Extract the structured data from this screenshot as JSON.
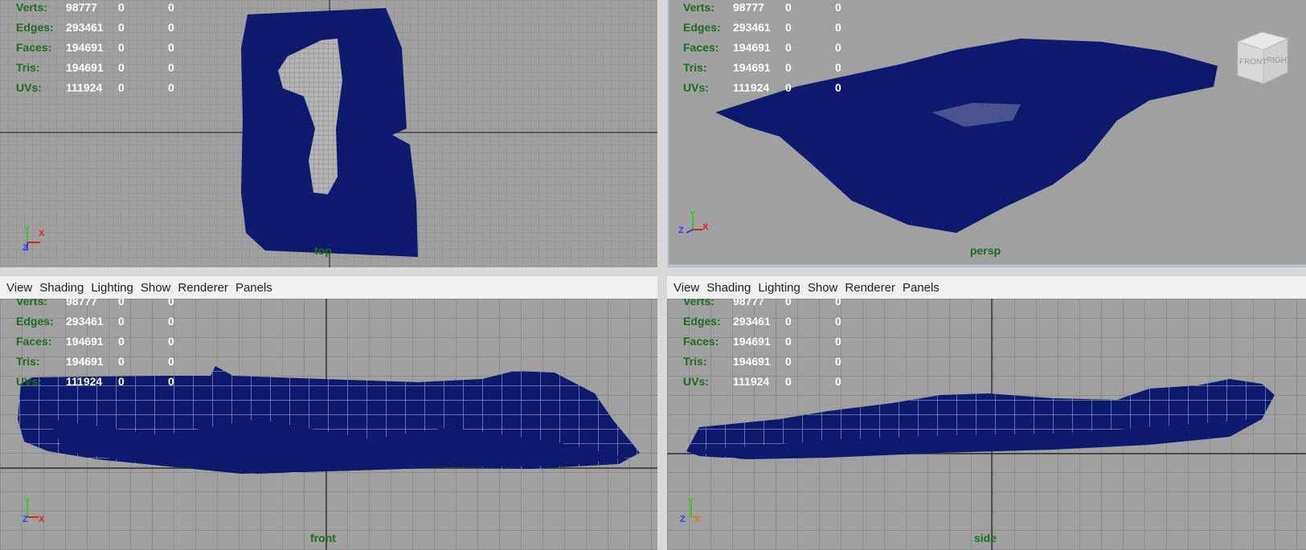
{
  "menu": [
    "View",
    "Shading",
    "Lighting",
    "Show",
    "Renderer",
    "Panels"
  ],
  "hud": {
    "rows": [
      {
        "label": "Verts:",
        "v1": "98777",
        "v2": "0",
        "v3": "0"
      },
      {
        "label": "Edges:",
        "v1": "293461",
        "v2": "0",
        "v3": "0"
      },
      {
        "label": "Faces:",
        "v1": "194691",
        "v2": "0",
        "v3": "0"
      },
      {
        "label": "Tris:",
        "v1": "194691",
        "v2": "0",
        "v3": "0"
      },
      {
        "label": "UVs:",
        "v1": "111924",
        "v2": "0",
        "v3": "0"
      }
    ]
  },
  "viewports": {
    "top": {
      "name": "top",
      "axes": {
        "a": "Y",
        "b": "X",
        "c": "Z"
      }
    },
    "persp": {
      "name": "persp",
      "axes": {
        "a": "Y",
        "b": "X",
        "c": "Z"
      }
    },
    "front": {
      "name": "front",
      "axes": {
        "a": "Y",
        "b": "X",
        "c": "Z"
      }
    },
    "side": {
      "name": "side",
      "axes": {
        "a": "Y",
        "b": "X",
        "c": "Z"
      }
    }
  },
  "viewcube": {
    "front": "FRONT",
    "right": "RIGHT"
  },
  "colors": {
    "viewport_bg": "#a0a0a0",
    "grid": "#8c8c8c",
    "axis_line": "#303030",
    "mesh": "#0e1a6e",
    "hud_label": "#1a6e1a",
    "hud_value": "#ffffff"
  }
}
